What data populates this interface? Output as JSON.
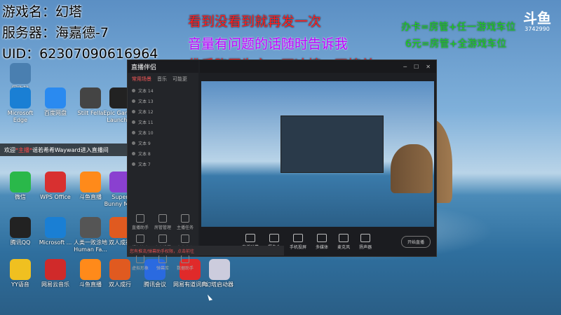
{
  "overlay": {
    "line1": "游戏名：幻塔",
    "line2": "服务器：海嘉德-7",
    "line3": "UID：62307090616964",
    "red1": "看到没看到就再发一次",
    "red2": "音量有问题的话随时告诉我",
    "red3": "佛系跑图为主，不冲榜，不接单",
    "green1": "办卡=房管+任一游戏车位",
    "green2": "6元=房管+全游戏车位"
  },
  "douyu": {
    "logo": "斗鱼",
    "room": "3742990"
  },
  "welcome": {
    "prefix": "欢迎",
    "mid": "*主播*",
    "text": "谣若希希Wayward进入直播间"
  },
  "desktop_icons": [
    {
      "label": "回收站",
      "color": "#4a7fb0"
    },
    {
      "label": "Microsoft Edge",
      "color": "#1a7fd4"
    },
    {
      "label": "百度网盘",
      "color": "#2a8af0"
    },
    {
      "label": "Stilt Fella",
      "color": "#444"
    },
    {
      "label": "Epic Games Launcher",
      "color": "#222"
    },
    {
      "label": "微信",
      "color": "#2ab84a"
    },
    {
      "label": "WPS Office",
      "color": "#d83030"
    },
    {
      "label": "斗鱼直播",
      "color": "#ff8a1a"
    },
    {
      "label": "Super Bunny Man",
      "color": "#8a40d0"
    },
    {
      "label": "腾讯QQ",
      "color": "#222"
    },
    {
      "label": "Microsoft ...",
      "color": "#1a7fd4"
    },
    {
      "label": "人类一败涂地 Human Fa...",
      "color": "#555"
    },
    {
      "label": "双人成行",
      "color": "#e05a20"
    },
    {
      "label": "YY语音",
      "color": "#f0c020"
    },
    {
      "label": "网易云音乐",
      "color": "#d02a2a"
    },
    {
      "label": "斗鱼直播",
      "color": "#ff8a1a"
    },
    {
      "label": "双人成行",
      "color": "#e05a20"
    },
    {
      "label": "腾讯会议",
      "color": "#2a6ae0"
    },
    {
      "label": "网易有道词典",
      "color": "#e02a2a"
    },
    {
      "label": "幻塔启动器",
      "color": "#ccd"
    }
  ],
  "app": {
    "title": "直播伴侣",
    "tabs": [
      "常用场景",
      "音乐",
      "可能更"
    ],
    "scenes": [
      "文本 14",
      "文本 13",
      "文本 12",
      "文本 11",
      "文本 10",
      "文本 9",
      "文本 8",
      "文本 7"
    ],
    "tools": [
      "直播助手",
      "房管管理",
      "主播任务",
      "视频连麦",
      "个人设置",
      "赛事中心",
      "虚拟形象",
      "弹幕库",
      "数据助手"
    ],
    "bottom": [
      "直播弹幕",
      "摄像头",
      "手机投屏",
      "多媒体",
      "麦克风",
      "扬声器"
    ],
    "status": "您有推流/弹幕助手权限，点击前往",
    "start_button": "开始直播"
  }
}
